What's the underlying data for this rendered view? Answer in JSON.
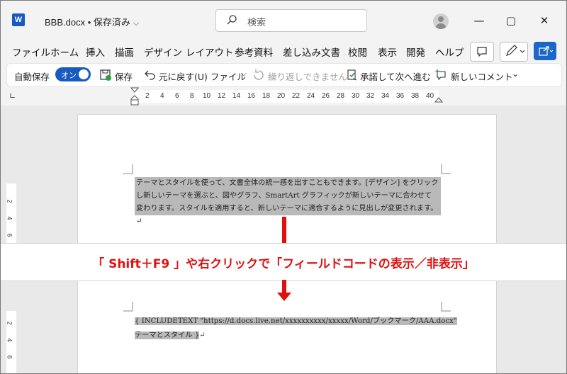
{
  "titlebar": {
    "app_icon": "word-icon",
    "doc_title": "BBB.docx • 保存済み",
    "search_placeholder": "検索",
    "window_controls": [
      "minimize-icon",
      "maximize-icon",
      "close-icon"
    ]
  },
  "menu": {
    "items": [
      "ファイル",
      "ホーム",
      "挿入",
      "描画",
      "デザイン",
      "レイアウト",
      "参考資料",
      "差し込み文書",
      "校閲",
      "表示",
      "開発",
      "ヘルプ"
    ]
  },
  "toolbar": {
    "autosave_label": "自動保存",
    "autosave_toggle": "オン",
    "save_label": "保存",
    "undo_label": "元に戻す(U) ファイル",
    "redo_label": "繰り返しできません",
    "accept_label": "承諾して次へ進む",
    "new_comment_label": "新しいコメント"
  },
  "ruler": {
    "ticks": [
      "2",
      "4",
      "6",
      "8",
      "10",
      "12",
      "14",
      "16",
      "18",
      "20",
      "22",
      "24",
      "26",
      "28",
      "30",
      "32",
      "34",
      "36",
      "38",
      "40"
    ]
  },
  "vertical_ruler": {
    "top_ticks": [
      "2",
      "4",
      "6"
    ],
    "bottom_ticks": [
      "2",
      "4",
      "6"
    ]
  },
  "document_top": {
    "lines": [
      "テーマとスタイルを使って、文書全体の統一感を出すこともできます。[デザイン] をクリック",
      "し新しいテーマを選ぶと、図やグラフ、SmartArt グラフィックが新しいテーマに合わせて",
      "変わります。スタイルを適用すると、新しいテーマに適合するように見出しが変更されます。↵"
    ]
  },
  "banner": {
    "text": "「 Shift＋F9 」や右クリックで「フィールドコードの表示／非表示」",
    "color": "#e01010"
  },
  "document_bottom": {
    "line1": "{ INCLUDETEXT \"https://d.docs.live.net/xxxxxxxxxx/xxxxx/Word/ブックマーク/AAA.docx\"",
    "line2": "テーマとスタイル }",
    "line2_mark": "↵"
  },
  "colors": {
    "accent": "#185abd",
    "arrow": "#e01010"
  }
}
